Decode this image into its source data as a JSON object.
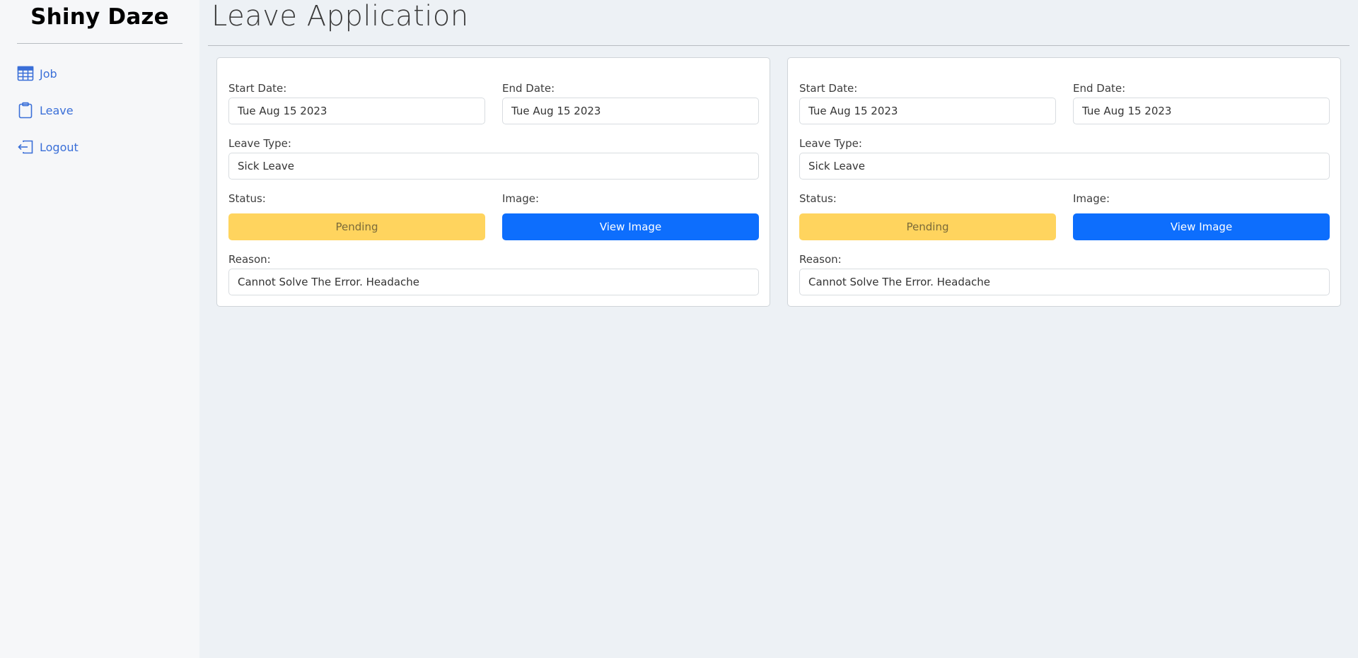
{
  "sidebar": {
    "brand": "Shiny Daze",
    "items": [
      {
        "label": "Job",
        "icon": "table-icon"
      },
      {
        "label": "Leave",
        "icon": "clipboard-icon"
      },
      {
        "label": "Logout",
        "icon": "logout-icon"
      }
    ]
  },
  "main": {
    "title": "Leave Application"
  },
  "labels": {
    "start_date": "Start Date:",
    "end_date": "End Date:",
    "leave_type": "Leave Type:",
    "status": "Status:",
    "image": "Image:",
    "reason": "Reason:"
  },
  "leaves": [
    {
      "start_date": "Tue Aug 15 2023",
      "end_date": "Tue Aug 15 2023",
      "leave_type": "Sick Leave",
      "status": "Pending",
      "view_image_label": "View Image",
      "reason": "Cannot Solve The Error. Headache"
    },
    {
      "start_date": "Tue Aug 15 2023",
      "end_date": "Tue Aug 15 2023",
      "leave_type": "Sick Leave",
      "status": "Pending",
      "view_image_label": "View Image",
      "reason": "Cannot Solve The Error. Headache"
    }
  ],
  "colors": {
    "accent": "#0d6efd",
    "pending": "#ffd45e",
    "nav_link": "#3a6fd8"
  }
}
